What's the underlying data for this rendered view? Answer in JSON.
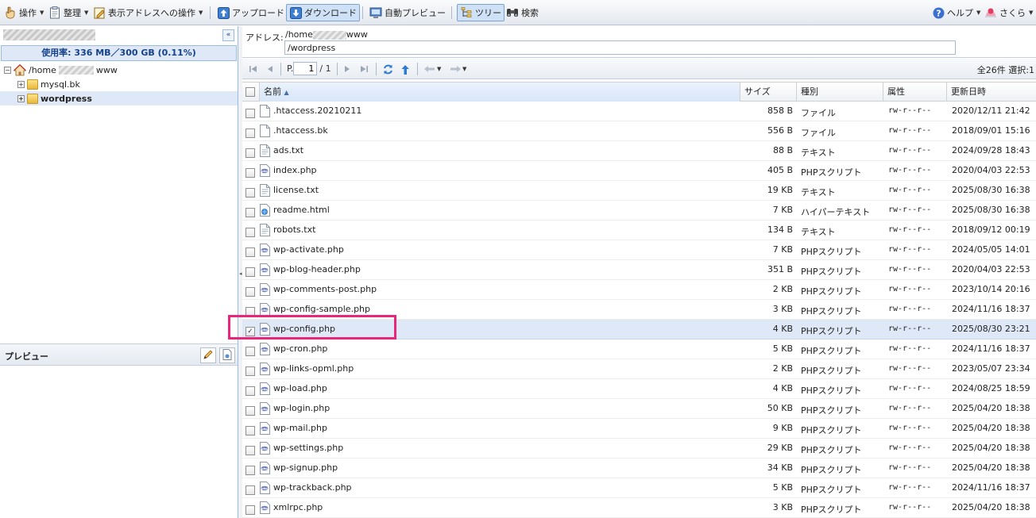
{
  "toolbar": {
    "operations_label": "操作",
    "organize_label": "整理",
    "address_ops_label": "表示アドレスへの操作",
    "upload_label": "アップロード",
    "download_label": "ダウンロード",
    "auto_preview_label": "自動プレビュー",
    "tree_label": "ツリー",
    "search_label": "検索",
    "help_label": "ヘルプ",
    "sakura_label": "さくら"
  },
  "left_panel": {
    "usage_text": "使用率: 336 MB／300 GB (0.11%)",
    "tree": {
      "root_prefix": "/home",
      "root_suffix": "www",
      "children": [
        {
          "label": "mysql.bk"
        },
        {
          "label": "wordpress"
        }
      ]
    },
    "preview_title": "プレビュー"
  },
  "address": {
    "label": "アドレス:",
    "line_prefix": "/home",
    "line_suffix": "www",
    "value": "/wordpress"
  },
  "pager": {
    "page_prefix": "P.",
    "current_page": "1",
    "total_pages": "/ 1",
    "summary": "全26件 選択:1"
  },
  "columns": {
    "name": "名前",
    "size": "サイズ",
    "kind": "種別",
    "attr": "属性",
    "modified": "更新日時"
  },
  "files": [
    {
      "name": ".htaccess.20210211",
      "size": "858 B",
      "kind": "ファイル",
      "attr": "rw-r--r--",
      "modified": "2020/12/11 21:42",
      "icon": "file-icon",
      "checked": false
    },
    {
      "name": ".htaccess.bk",
      "size": "556 B",
      "kind": "ファイル",
      "attr": "rw-r--r--",
      "modified": "2018/09/01 15:16",
      "icon": "file-icon",
      "checked": false
    },
    {
      "name": "ads.txt",
      "size": "88 B",
      "kind": "テキスト",
      "attr": "rw-r--r--",
      "modified": "2024/09/28 18:43",
      "icon": "text-file-icon",
      "checked": false
    },
    {
      "name": "index.php",
      "size": "405 B",
      "kind": "PHPスクリプト",
      "attr": "rw-r--r--",
      "modified": "2020/04/03 22:53",
      "icon": "php-file-icon",
      "checked": false
    },
    {
      "name": "license.txt",
      "size": "19 KB",
      "kind": "テキスト",
      "attr": "rw-r--r--",
      "modified": "2025/08/30 16:38",
      "icon": "text-file-icon",
      "checked": false
    },
    {
      "name": "readme.html",
      "size": "7 KB",
      "kind": "ハイパーテキスト",
      "attr": "rw-r--r--",
      "modified": "2025/08/30 16:38",
      "icon": "html-file-icon",
      "checked": false
    },
    {
      "name": "robots.txt",
      "size": "134 B",
      "kind": "テキスト",
      "attr": "rw-r--r--",
      "modified": "2018/09/12 00:19",
      "icon": "text-file-icon",
      "checked": false
    },
    {
      "name": "wp-activate.php",
      "size": "7 KB",
      "kind": "PHPスクリプト",
      "attr": "rw-r--r--",
      "modified": "2024/05/05 14:01",
      "icon": "php-file-icon",
      "checked": false
    },
    {
      "name": "wp-blog-header.php",
      "size": "351 B",
      "kind": "PHPスクリプト",
      "attr": "rw-r--r--",
      "modified": "2020/04/03 22:53",
      "icon": "php-file-icon",
      "checked": false
    },
    {
      "name": "wp-comments-post.php",
      "size": "2 KB",
      "kind": "PHPスクリプト",
      "attr": "rw-r--r--",
      "modified": "2023/10/14 20:16",
      "icon": "php-file-icon",
      "checked": false
    },
    {
      "name": "wp-config-sample.php",
      "size": "3 KB",
      "kind": "PHPスクリプト",
      "attr": "rw-r--r--",
      "modified": "2024/11/16 18:37",
      "icon": "php-file-icon",
      "checked": false
    },
    {
      "name": "wp-config.php",
      "size": "4 KB",
      "kind": "PHPスクリプト",
      "attr": "rw-r--r--",
      "modified": "2025/08/30 23:21",
      "icon": "php-file-icon",
      "checked": true
    },
    {
      "name": "wp-cron.php",
      "size": "5 KB",
      "kind": "PHPスクリプト",
      "attr": "rw-r--r--",
      "modified": "2024/11/16 18:37",
      "icon": "php-file-icon",
      "checked": false
    },
    {
      "name": "wp-links-opml.php",
      "size": "2 KB",
      "kind": "PHPスクリプト",
      "attr": "rw-r--r--",
      "modified": "2023/05/07 23:34",
      "icon": "php-file-icon",
      "checked": false
    },
    {
      "name": "wp-load.php",
      "size": "4 KB",
      "kind": "PHPスクリプト",
      "attr": "rw-r--r--",
      "modified": "2024/08/25 18:59",
      "icon": "php-file-icon",
      "checked": false
    },
    {
      "name": "wp-login.php",
      "size": "50 KB",
      "kind": "PHPスクリプト",
      "attr": "rw-r--r--",
      "modified": "2025/04/20 18:38",
      "icon": "php-file-icon",
      "checked": false
    },
    {
      "name": "wp-mail.php",
      "size": "9 KB",
      "kind": "PHPスクリプト",
      "attr": "rw-r--r--",
      "modified": "2025/04/20 18:38",
      "icon": "php-file-icon",
      "checked": false
    },
    {
      "name": "wp-settings.php",
      "size": "29 KB",
      "kind": "PHPスクリプト",
      "attr": "rw-r--r--",
      "modified": "2025/04/20 18:38",
      "icon": "php-file-icon",
      "checked": false
    },
    {
      "name": "wp-signup.php",
      "size": "34 KB",
      "kind": "PHPスクリプト",
      "attr": "rw-r--r--",
      "modified": "2025/04/20 18:38",
      "icon": "php-file-icon",
      "checked": false
    },
    {
      "name": "wp-trackback.php",
      "size": "5 KB",
      "kind": "PHPスクリプト",
      "attr": "rw-r--r--",
      "modified": "2024/11/16 18:37",
      "icon": "php-file-icon",
      "checked": false
    },
    {
      "name": "xmlrpc.php",
      "size": "3 KB",
      "kind": "PHPスクリプト",
      "attr": "rw-r--r--",
      "modified": "2025/04/20 18:38",
      "icon": "php-file-icon",
      "checked": false
    }
  ],
  "colors": {
    "selection": "#dfe8f6",
    "highlight_border": "#e8277a",
    "usage_text": "#15428b"
  }
}
